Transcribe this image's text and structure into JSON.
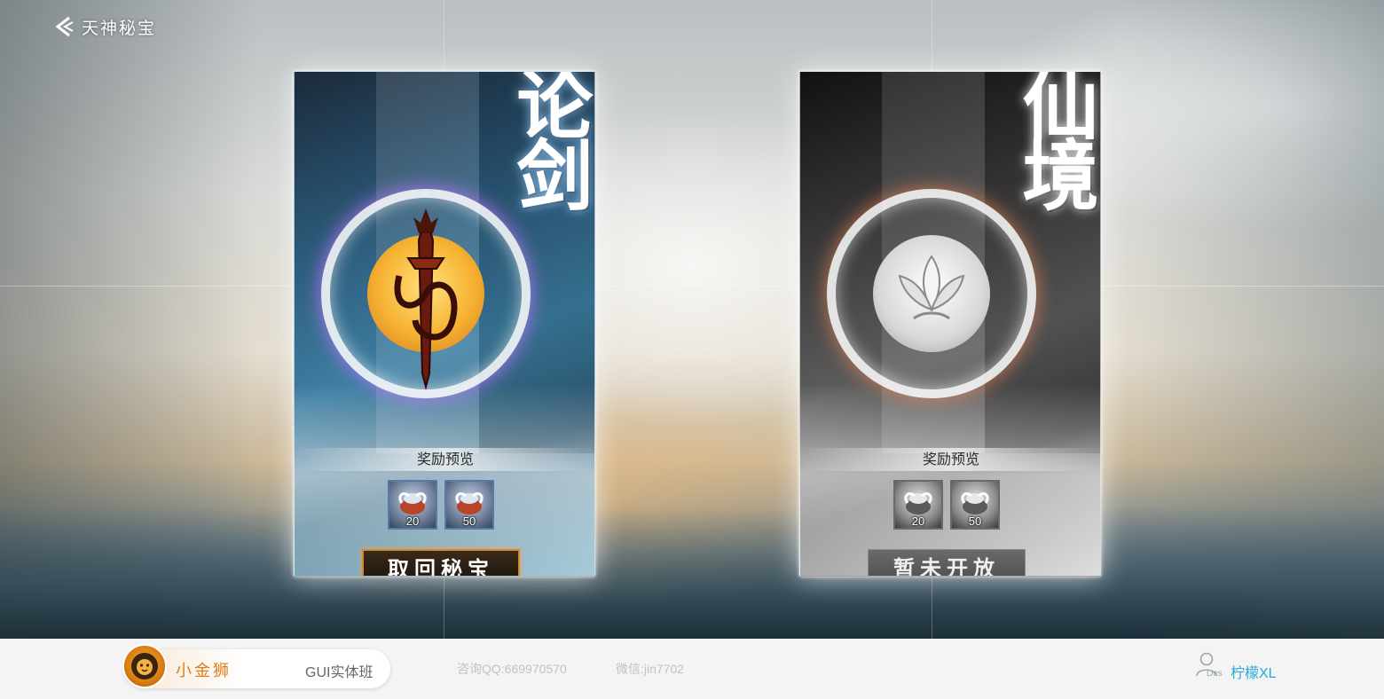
{
  "header": {
    "back_label": "天神秘宝"
  },
  "cards": [
    {
      "title": "论剑",
      "reward_label": "奖励预览",
      "rewards": [
        {
          "count": "20"
        },
        {
          "count": "50"
        }
      ],
      "button_label": "取回秘宝",
      "state": "active",
      "theme_color": "#3d7fa3"
    },
    {
      "title": "仙境",
      "reward_label": "奖励预览",
      "rewards": [
        {
          "count": "20"
        },
        {
          "count": "50"
        }
      ],
      "button_label": "暂未开放",
      "state": "locked",
      "theme_color": "#5e5e5e"
    }
  ],
  "footer": {
    "brand_name": "小金狮",
    "course": "GUI实体班",
    "qq": "咨询QQ:669970570",
    "wechat": "微信:jin7702",
    "author_tag": "Des",
    "author_name": "柠檬XL",
    "brand_color": "#e17b15",
    "author_color": "#2aa8d8"
  }
}
